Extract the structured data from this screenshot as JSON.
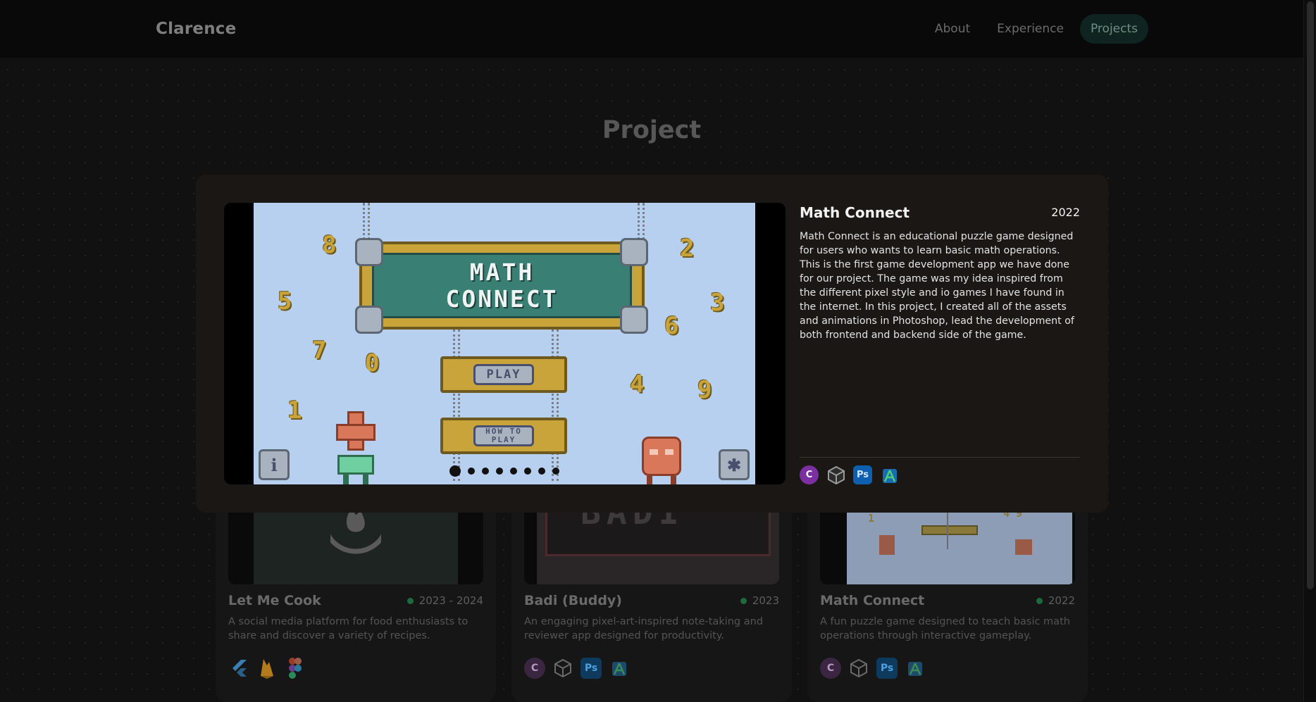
{
  "nav": {
    "brand": "Clarence",
    "links": [
      "About",
      "Experience",
      "Projects"
    ]
  },
  "page": {
    "heading": "Project"
  },
  "modal": {
    "title": "Math Connect",
    "year": "2022",
    "description": "Math Connect is an educational puzzle game designed for users who wants to learn basic math operations. This is the first game development app we have done for our project. The game was my idea inspired from the different pixel style and io games I have found in the internet. In this project, I created all of the assets and animations in Photoshop, lead the development of both frontend and backend side of the game.",
    "game": {
      "title_line1": "MATH",
      "title_line2": "CONNECT",
      "play_label": "PLAY",
      "howto_label_1": "HOW TO",
      "howto_label_2": "PLAY",
      "info_label": "i",
      "settings_label": "✱",
      "numbers": [
        "8",
        "2",
        "5",
        "3",
        "7",
        "6",
        "0",
        "4",
        "9",
        "1"
      ]
    },
    "carousel": {
      "count": 8,
      "active": 1
    },
    "tech_icons": [
      "csharp-icon",
      "unity-icon",
      "photoshop-icon",
      "android-studio-icon"
    ]
  },
  "cards": [
    {
      "title": "Let Me Cook",
      "year": "2023 - 2024",
      "description": "A social media platform for food enthusiasts to share and discover a variety of recipes.",
      "tech_icons": [
        "flutter-icon",
        "firebase-icon",
        "figma-icon"
      ]
    },
    {
      "title": "Badi (Buddy)",
      "year": "2023",
      "description": "An engaging pixel-art-inspired note-taking and reviewer app designed for productivity.",
      "tech_icons": [
        "csharp-icon",
        "unity-icon",
        "photoshop-icon",
        "android-studio-icon"
      ]
    },
    {
      "title": "Math Connect",
      "year": "2022",
      "description": "A fun puzzle game designed to teach basic math operations through interactive gameplay.",
      "tech_icons": [
        "csharp-icon",
        "unity-icon",
        "photoshop-icon",
        "android-studio-icon"
      ]
    }
  ],
  "icon_text": {
    "photoshop": "Ps",
    "csharp": "C"
  },
  "colors": {
    "accent_green": "#1d6a3d",
    "nav_active_bg": "#0f2420",
    "modal_bg": "#1b1715",
    "game_sky": "#b8d0ef"
  }
}
